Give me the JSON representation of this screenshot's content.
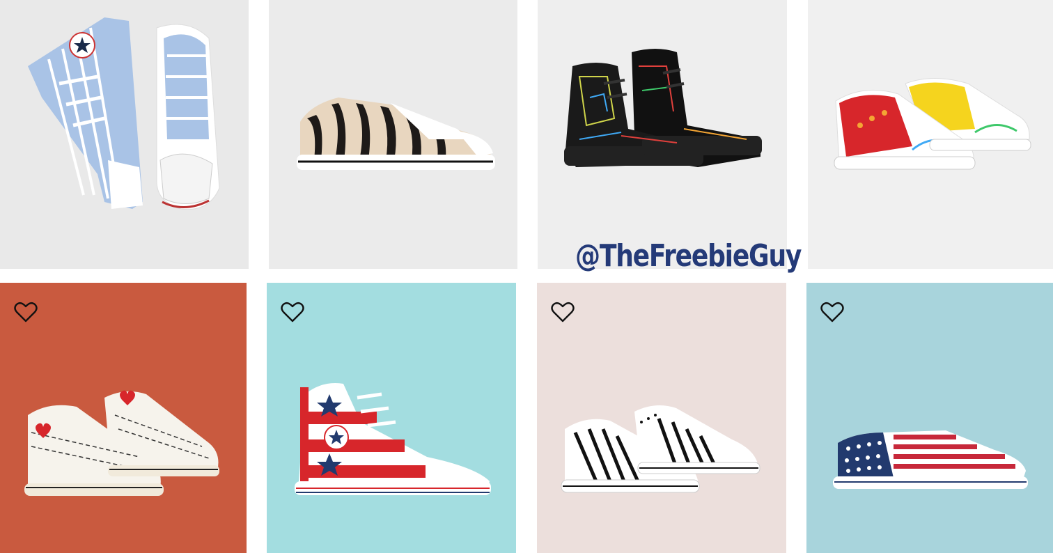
{
  "watermark": "@TheFreebieGuy",
  "colors": {
    "top_tile_bg": "#e9e9e9",
    "tile_red": "#c95a3f",
    "tile_cyan": "#a3dde0",
    "tile_blush": "#ecdfdc",
    "tile_lightblue": "#a8d4dc",
    "watermark": "#243a78"
  },
  "top_row": [
    {
      "name": "blue-white-striped-high-top-sneakers"
    },
    {
      "name": "zebra-print-low-top-sneaker"
    },
    {
      "name": "black-leather-multicolor-stitch-high-tops"
    },
    {
      "name": "rainbow-accent-low-top-sneakers"
    }
  ],
  "bottom_row": [
    {
      "name": "love-fearlessly-low-top-sneakers",
      "heart_icon": "heart-outline-icon"
    },
    {
      "name": "stars-and-stripes-high-top-sneaker",
      "heart_icon": "heart-outline-icon"
    },
    {
      "name": "black-white-stripe-low-top-sneakers",
      "heart_icon": "heart-outline-icon"
    },
    {
      "name": "american-flag-low-top-sneaker",
      "heart_icon": "heart-outline-icon"
    }
  ]
}
